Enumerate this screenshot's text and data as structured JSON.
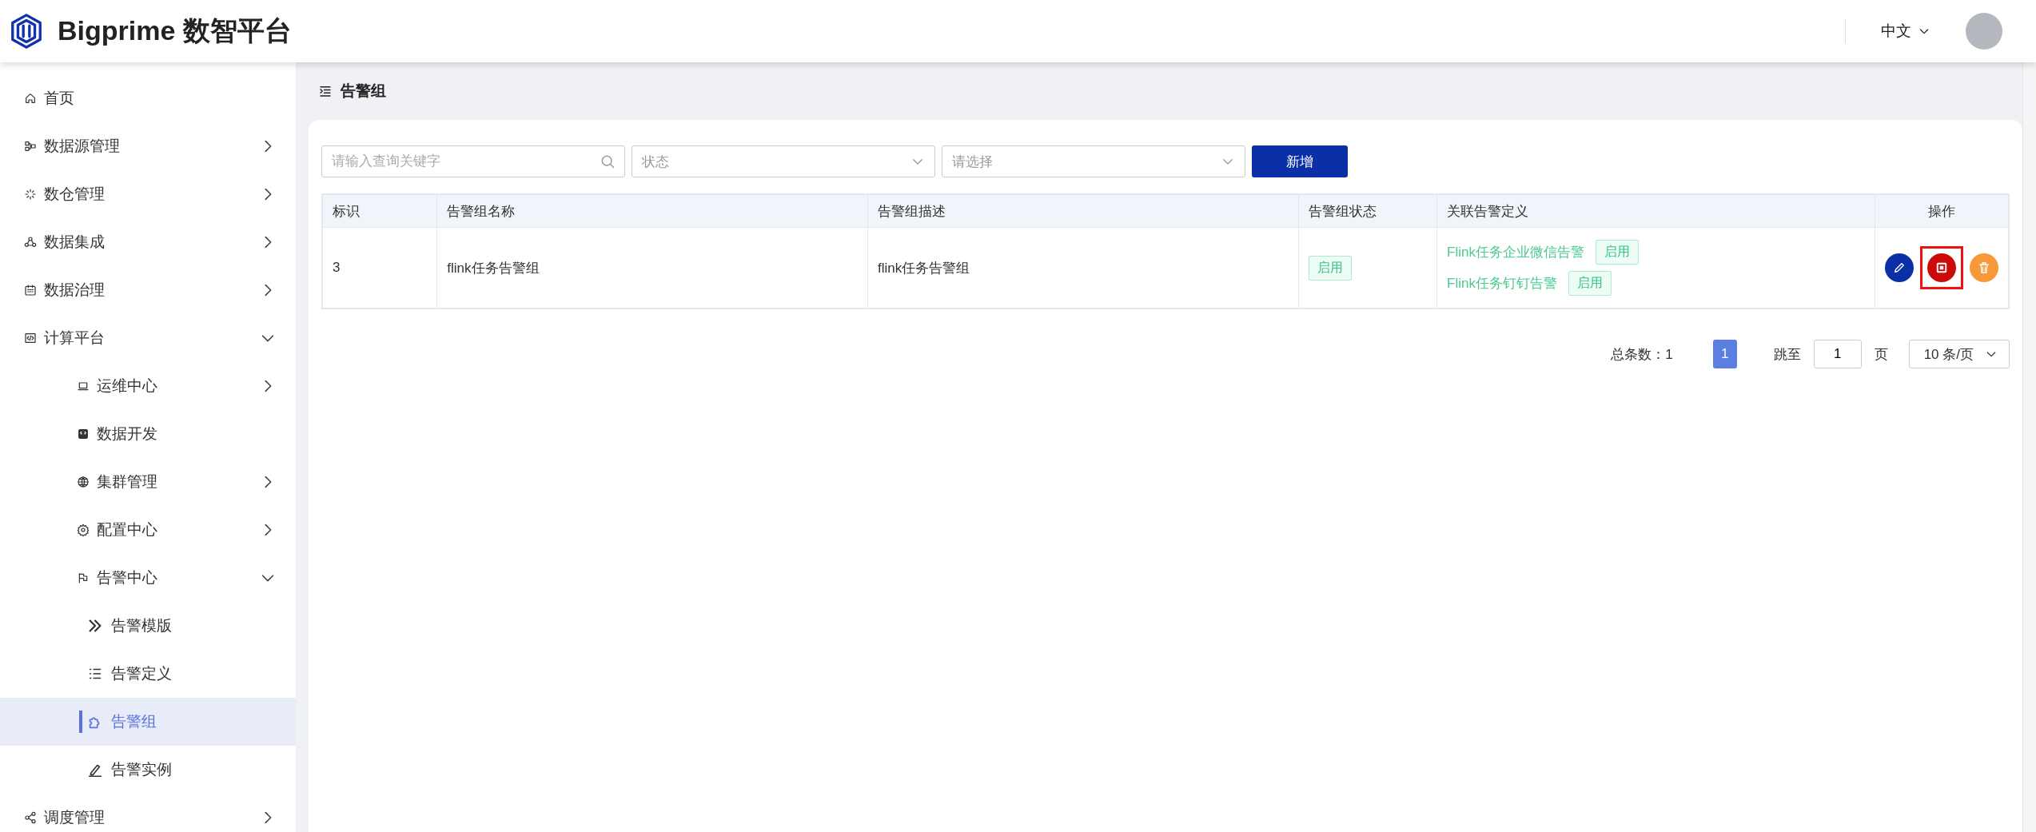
{
  "header": {
    "brand": "Bigprime 数智平台",
    "language": "中文"
  },
  "sidebar": {
    "items": [
      {
        "kind": "link",
        "label": "首页",
        "selected": false
      },
      {
        "kind": "group",
        "label": "数据源管理",
        "expanded": false,
        "selected": false
      },
      {
        "kind": "group",
        "label": "数仓管理",
        "expanded": false,
        "selected": false
      },
      {
        "kind": "group",
        "label": "数据集成",
        "expanded": false,
        "selected": false
      },
      {
        "kind": "group",
        "label": "数据治理",
        "expanded": false,
        "selected": false
      },
      {
        "kind": "group",
        "label": "计算平台",
        "expanded": true,
        "selected": false,
        "children": [
          {
            "kind": "group",
            "label": "运维中心",
            "expanded": false,
            "selected": false
          },
          {
            "kind": "link",
            "label": "数据开发",
            "selected": false
          },
          {
            "kind": "group",
            "label": "集群管理",
            "expanded": false,
            "selected": false
          },
          {
            "kind": "group",
            "label": "配置中心",
            "expanded": false,
            "selected": false
          },
          {
            "kind": "group",
            "label": "告警中心",
            "expanded": true,
            "selected": false,
            "children": [
              {
                "kind": "link",
                "label": "告警模版",
                "selected": false
              },
              {
                "kind": "link",
                "label": "告警定义",
                "selected": false
              },
              {
                "kind": "link",
                "label": "告警组",
                "selected": true
              },
              {
                "kind": "link",
                "label": "告警实例",
                "selected": false
              }
            ]
          }
        ]
      },
      {
        "kind": "group",
        "label": "调度管理",
        "expanded": false,
        "selected": false
      }
    ]
  },
  "page": {
    "title": "告警组"
  },
  "toolbar": {
    "search": {
      "placeholder": "请输入查询关键字"
    },
    "status_select": {
      "placeholder": "状态"
    },
    "type_select": {
      "placeholder": "请选择"
    },
    "add_button": "新增"
  },
  "table": {
    "columns": [
      "标识",
      "告警组名称",
      "告警组描述",
      "告警组状态",
      "关联告警定义",
      "操作"
    ],
    "rows": [
      {
        "id": "3",
        "name": "flink任务告警组",
        "description": "flink任务告警组",
        "status": {
          "label": "启用",
          "on": true
        },
        "definitions": [
          {
            "name": "Flink任务企业微信告警",
            "status": {
              "label": "启用",
              "on": true
            }
          },
          {
            "name": "Flink任务钉钉告警",
            "status": {
              "label": "启用",
              "on": true
            }
          }
        ],
        "actions": [
          {
            "kind": "edit",
            "highlighted": false
          },
          {
            "kind": "stop",
            "highlighted": true
          },
          {
            "kind": "delete",
            "highlighted": false
          }
        ]
      }
    ]
  },
  "pagination": {
    "total": "总条数：1",
    "pages": [
      {
        "label": "1",
        "selected": true
      }
    ],
    "jump_label": "跳至",
    "jump_value": "1",
    "page_unit": "页",
    "page_size": "10 条/页"
  }
}
